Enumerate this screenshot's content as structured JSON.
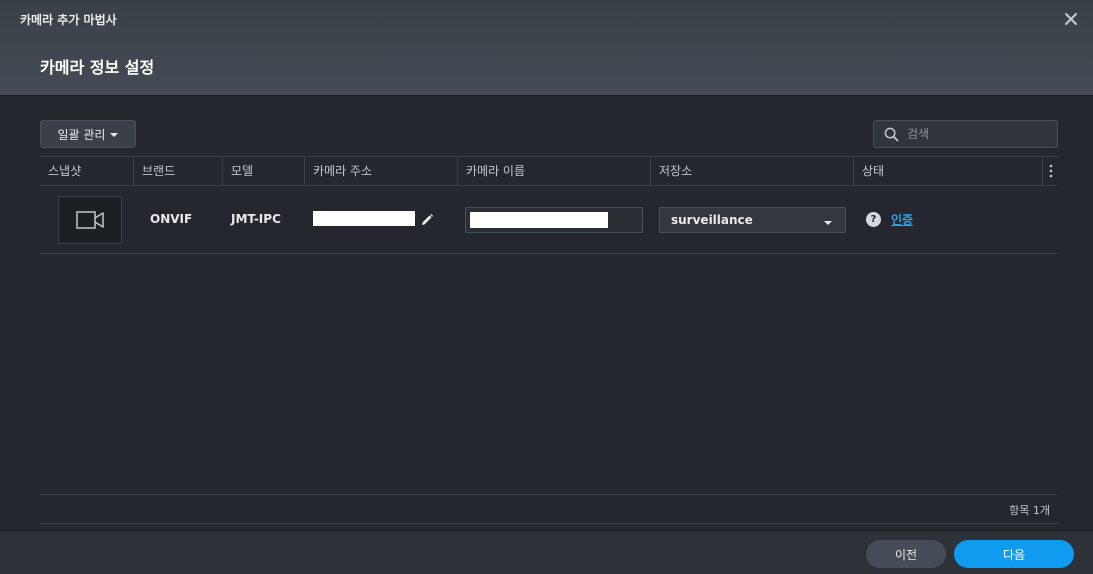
{
  "window": {
    "title": "카메라 추가 마법사"
  },
  "step": {
    "title": "카메라 정보 설정"
  },
  "toolbar": {
    "batch_label": "일괄 관리"
  },
  "search": {
    "placeholder": "검색"
  },
  "table": {
    "columns": [
      "스냅샷",
      "브랜드",
      "모델",
      "카메라 주소",
      "카메라 이름",
      "저장소",
      "상태"
    ],
    "rows": [
      {
        "snapshot_icon": "video-camera-icon",
        "brand": "ONVIF",
        "model": "JMT-IPC",
        "address": "",
        "name": "",
        "storage": "surveillance",
        "status_link": "인증"
      }
    ],
    "item_count": "항목 1개"
  },
  "footer": {
    "prev_label": "이전",
    "next_label": "다음"
  },
  "colors": {
    "accent": "#0f9bf0",
    "link": "#26a5f0",
    "background": "#24272d",
    "header": "#3f454e"
  }
}
